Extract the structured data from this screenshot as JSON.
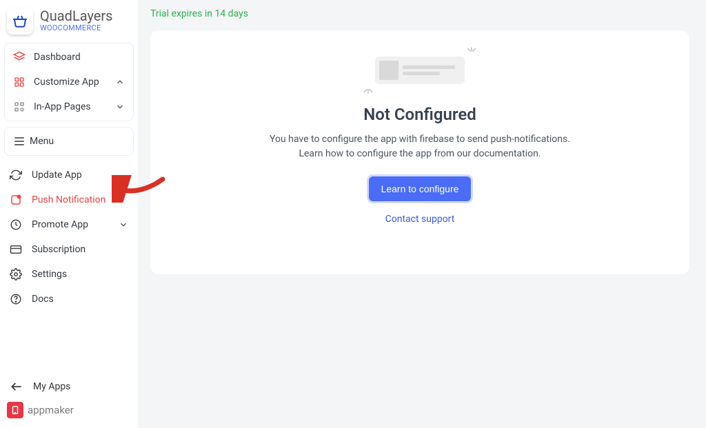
{
  "brand": {
    "title": "QuadLayers",
    "subtitle": "WOOCOMMERCE"
  },
  "trial_banner": "Trial expires in 14 days",
  "nav_group_main": {
    "dashboard": "Dashboard",
    "customize": "Customize App",
    "inapp": "In-App Pages",
    "menu": "Menu"
  },
  "nav_plain": {
    "update": "Update App",
    "push": "Push Notification",
    "promote": "Promote App",
    "subscription": "Subscription",
    "settings": "Settings",
    "docs": "Docs"
  },
  "sidebar_footer": {
    "myapps": "My Apps",
    "appmaker": "appmaker"
  },
  "panel": {
    "title": "Not Configured",
    "line1": "You have to configure the app with firebase to send push-notifications.",
    "line2": "Learn how to configure the app from our documentation.",
    "cta": "Learn to configure",
    "support": "Contact support"
  }
}
